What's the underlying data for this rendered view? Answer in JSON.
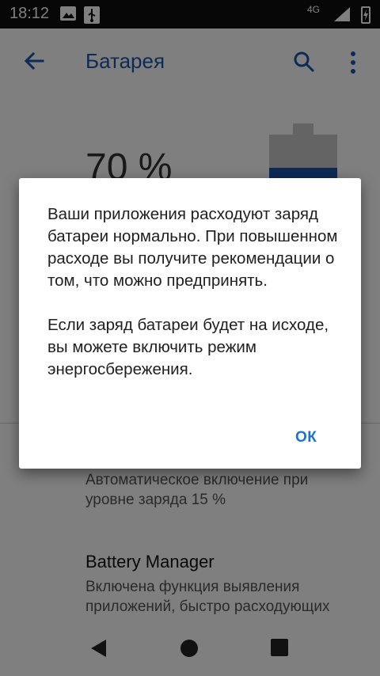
{
  "status_bar": {
    "time": "18:12",
    "network_label": "4G",
    "icons": [
      "image-icon",
      "usb-icon",
      "signal-icon",
      "battery-charging-icon"
    ]
  },
  "app_bar": {
    "title": "Батарея",
    "icons": [
      "back-arrow-icon",
      "search-icon",
      "more-vert-icon"
    ],
    "accent_color": "#1b56a8"
  },
  "battery": {
    "level_text": "70 %",
    "level_fraction": 0.7
  },
  "settings": {
    "item1_summary": "Автоматическое включение при уровне заряда 15 %",
    "item2_title": "Battery Manager",
    "item2_summary": "Включена функция выявления приложений, быстро расходующих"
  },
  "dialog": {
    "paragraph1": "Ваши приложения расходуют заряд батареи нормально. При повышенном расходе вы получите рекомендации о том, что можно предпринять.",
    "paragraph2": "Если заряд батареи будет на исходе, вы можете включить режим энергосбережения.",
    "ok_label": "ОК",
    "button_color": "#1f72c9"
  },
  "nav_bar": {
    "icons": [
      "nav-back-icon",
      "nav-home-icon",
      "nav-recents-icon"
    ]
  }
}
